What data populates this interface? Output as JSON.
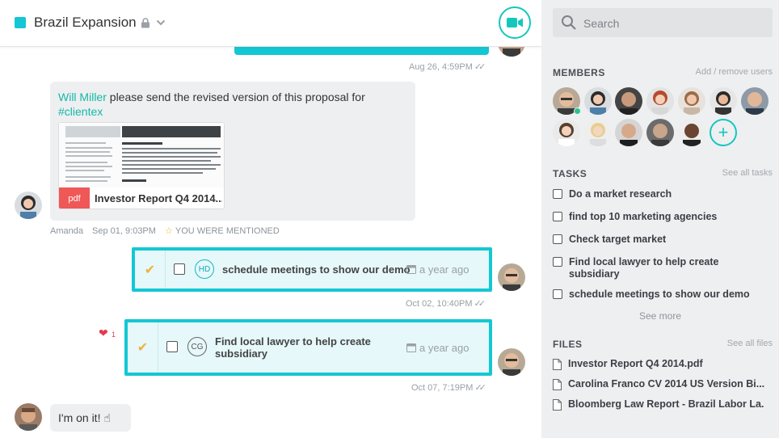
{
  "header": {
    "channel_name": "Brazil Expansion",
    "accent_color": "#14c7d4"
  },
  "messages": {
    "first_time": "Aug 26, 4:59PM",
    "proposal": {
      "mention": "Will Miller",
      "text": " please send the revised version of this proposal for ",
      "hashtag": "#clientex",
      "attachment_type": "pdf",
      "attachment_name": "Investor Report Q4 2014....",
      "author": "Amanda",
      "time": "Sep 01, 9:03PM",
      "mention_note": "YOU WERE MENTIONED"
    },
    "task1": {
      "initials": "HD",
      "text": "schedule meetings to show our demo",
      "due": "a year ago",
      "time": "Oct 02, 10:40PM"
    },
    "task2": {
      "initials": "CG",
      "text": "Find local lawyer to help create subsidiary",
      "due": "a year ago",
      "time": "Oct 07, 7:19PM",
      "reaction_count": "1"
    },
    "last": {
      "text": "I'm on it! ☝"
    }
  },
  "sidebar": {
    "search_placeholder": "Search",
    "members": {
      "title": "MEMBERS",
      "link": "Add / remove users"
    },
    "tasks": {
      "title": "TASKS",
      "link": "See all tasks",
      "items": [
        "Do a market research",
        "find top 10 marketing agencies",
        "Check target market",
        "Find local lawyer to help create subsidiary",
        "schedule meetings to show our demo"
      ],
      "see_more": "See more"
    },
    "files": {
      "title": "FILES",
      "link": "See all files",
      "items": [
        "Investor Report Q4 2014.pdf",
        "Carolina Franco CV 2014 US Version Bi...",
        "Bloomberg Law Report - Brazil Labor La..."
      ]
    }
  }
}
